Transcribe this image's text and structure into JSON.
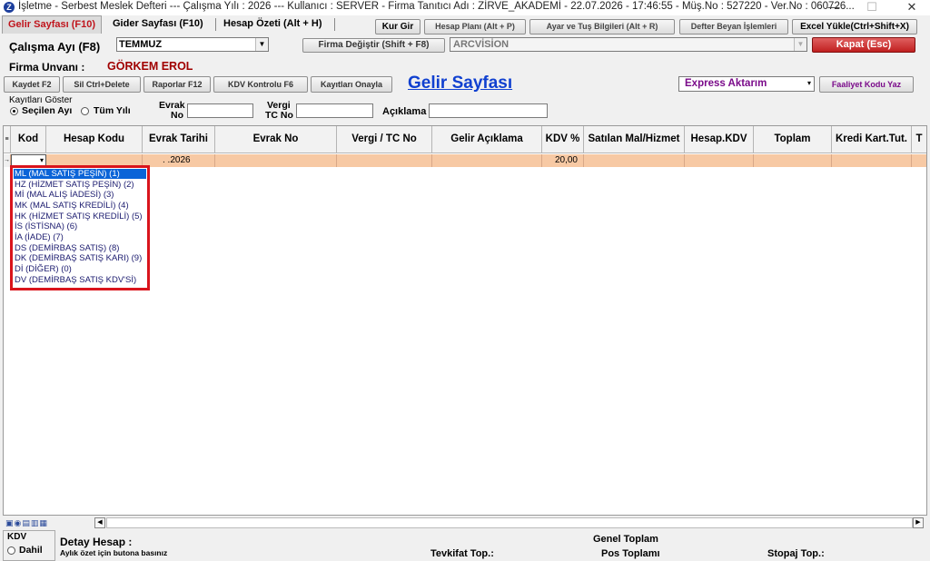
{
  "window": {
    "title": "İşletme - Serbest Meslek Defteri  ---  Çalışma Yılı : 2026  ---  Kullanıcı : SERVER - Firma Tanıtıcı Adı : ZİRVE_AKADEMİ - 22.07.2026 - 17:46:55 - Müş.No : 527220 - Ver.No : 060726...",
    "minimize": "—",
    "maximize": "☐",
    "close": "✕"
  },
  "tabs": [
    "Gelir Sayfası (F10)",
    "Gider Sayfası (F10)",
    "Hesap Özeti (Alt + H)"
  ],
  "toolbar": {
    "kur_gir": "Kur Gir",
    "hesap_plani": "Hesap Planı (Alt + P)",
    "ayar": "Ayar ve Tuş Bilgileri (Alt + R)",
    "defter_beyan": "Defter Beyan İşlemleri",
    "excel_yukle": "Excel Yükle(Ctrl+Shift+X)",
    "firma_degistir": "Firma Değiştir (Shift + F8)",
    "kapat": "Kapat (Esc)"
  },
  "calisma": {
    "label": "Çalışma Ayı (F8)",
    "value": "TEMMUZ"
  },
  "firma_combo": "ARCVİSİON",
  "firma": {
    "label": "Firma Unvanı :",
    "value": "GÖRKEM EROL"
  },
  "actions": {
    "kaydet": "Kaydet F2",
    "sil": "Sil Ctrl+Delete",
    "raporlar": "Raporlar F12",
    "kdv_kontrol": "KDV Kontrolu F6",
    "kayitlari_onayla": "Kayıtları Onayla"
  },
  "page_title": "Gelir Sayfası",
  "express": {
    "value": "Express Aktarım",
    "faaliyet": "Faaliyet Kodu Yaz"
  },
  "filter": {
    "group_label": "Kayıtları Göster",
    "secilen": "Seçilen Ayı",
    "tum": "Tüm Yılı",
    "evrak_label1": "Evrak",
    "evrak_label2": "No",
    "vergi_label1": "Vergi",
    "vergi_label2": "TC No",
    "aciklama_label": "Açıklama"
  },
  "grid": {
    "columns": [
      "Kod",
      "Hesap Kodu",
      "Evrak Tarihi",
      "Evrak No",
      "Vergi / TC No",
      "Gelir Açıklama",
      "KDV %",
      "Satılan Mal/Hizmet",
      "Hesap.KDV",
      "Toplam",
      "Kredi Kart.Tut.",
      "T"
    ],
    "row1": {
      "evrak_tarihi": ". .2026",
      "kdv": "20,00"
    }
  },
  "dropdown": [
    "ML (MAL SATIŞ PEŞİN) (1)",
    "HZ (HİZMET SATIŞ PEŞİN) (2)",
    "Mİ (MAL ALIŞ İADESİ) (3)",
    "MK (MAL SATIŞ KREDİLİ) (4)",
    "HK (HİZMET SATIŞ KREDİLİ) (5)",
    "İS (İSTİSNA) (6)",
    "İA (İADE) (7)",
    "DS (DEMİRBAŞ SATIŞ) (8)",
    "DK (DEMİRBAŞ SATIŞ KARI) (9)",
    "Dİ (DİĞER) (0)",
    "DV (DEMİRBAŞ SATIŞ KDV'Sİ)"
  ],
  "bottom": {
    "kdv": "KDV",
    "dahil": "Dahil",
    "detay_hesap": "Detay Hesap :",
    "aylik_ozet": "Aylık özet için butona basınız",
    "genel_toplam": "Genel Toplam",
    "tevkifat": "Tevkifat Top.:",
    "pos": "Pos Toplamı",
    "stopaj": "Stopaj Top.:"
  }
}
